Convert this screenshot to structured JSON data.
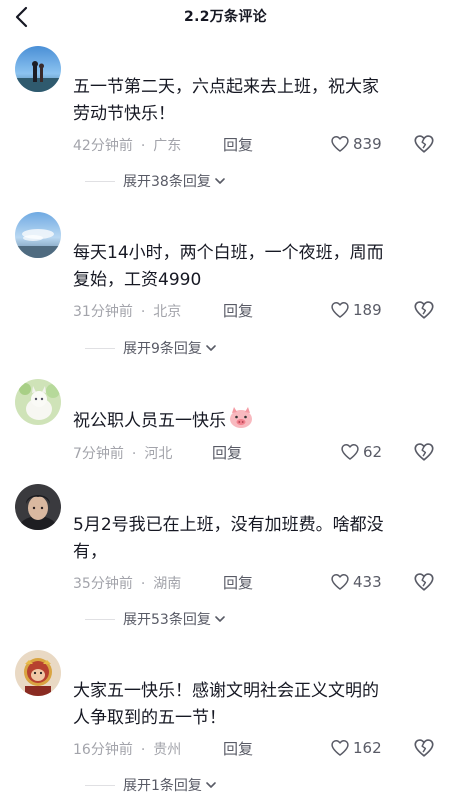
{
  "header": {
    "title": "2.2万条评论"
  },
  "comments": [
    {
      "text": "五一节第二天，六点起来去上班，祝大家\n劳动节快乐！",
      "time": "42分钟前",
      "location": "广东",
      "reply_label": "回复",
      "likes": "839",
      "expand_label": "展开38条回复"
    },
    {
      "text": "每天14小时，两个白班，一个夜班，周而\n复始，工资4990",
      "time": "31分钟前",
      "location": "北京",
      "reply_label": "回复",
      "likes": "189",
      "expand_label": "展开9条回复"
    },
    {
      "text": "祝公职人员五一快乐",
      "time": "7分钟前",
      "location": "河北",
      "reply_label": "回复",
      "likes": "62",
      "emoji": "pig-face-emoji"
    },
    {
      "text": "5月2号我已在上班，没有加班费。啥都没\n有，",
      "time": "35分钟前",
      "location": "湖南",
      "reply_label": "回复",
      "likes": "433",
      "expand_label": "展开53条回复"
    },
    {
      "text": "大家五一快乐！感谢文明社会正义文明的\n人争取到的五一节！",
      "time": "16分钟前",
      "location": "贵州",
      "reply_label": "回复",
      "likes": "162",
      "expand_label": "展开1条回复"
    }
  ],
  "icons": {
    "back": "chevron-left-icon",
    "like": "heart-outline-icon",
    "dislike": "broken-heart-icon",
    "expand": "chevron-down-icon"
  },
  "colors": {
    "text_primary": "#161823",
    "text_meta": "#a3a4ab",
    "text_action": "#595b66"
  }
}
